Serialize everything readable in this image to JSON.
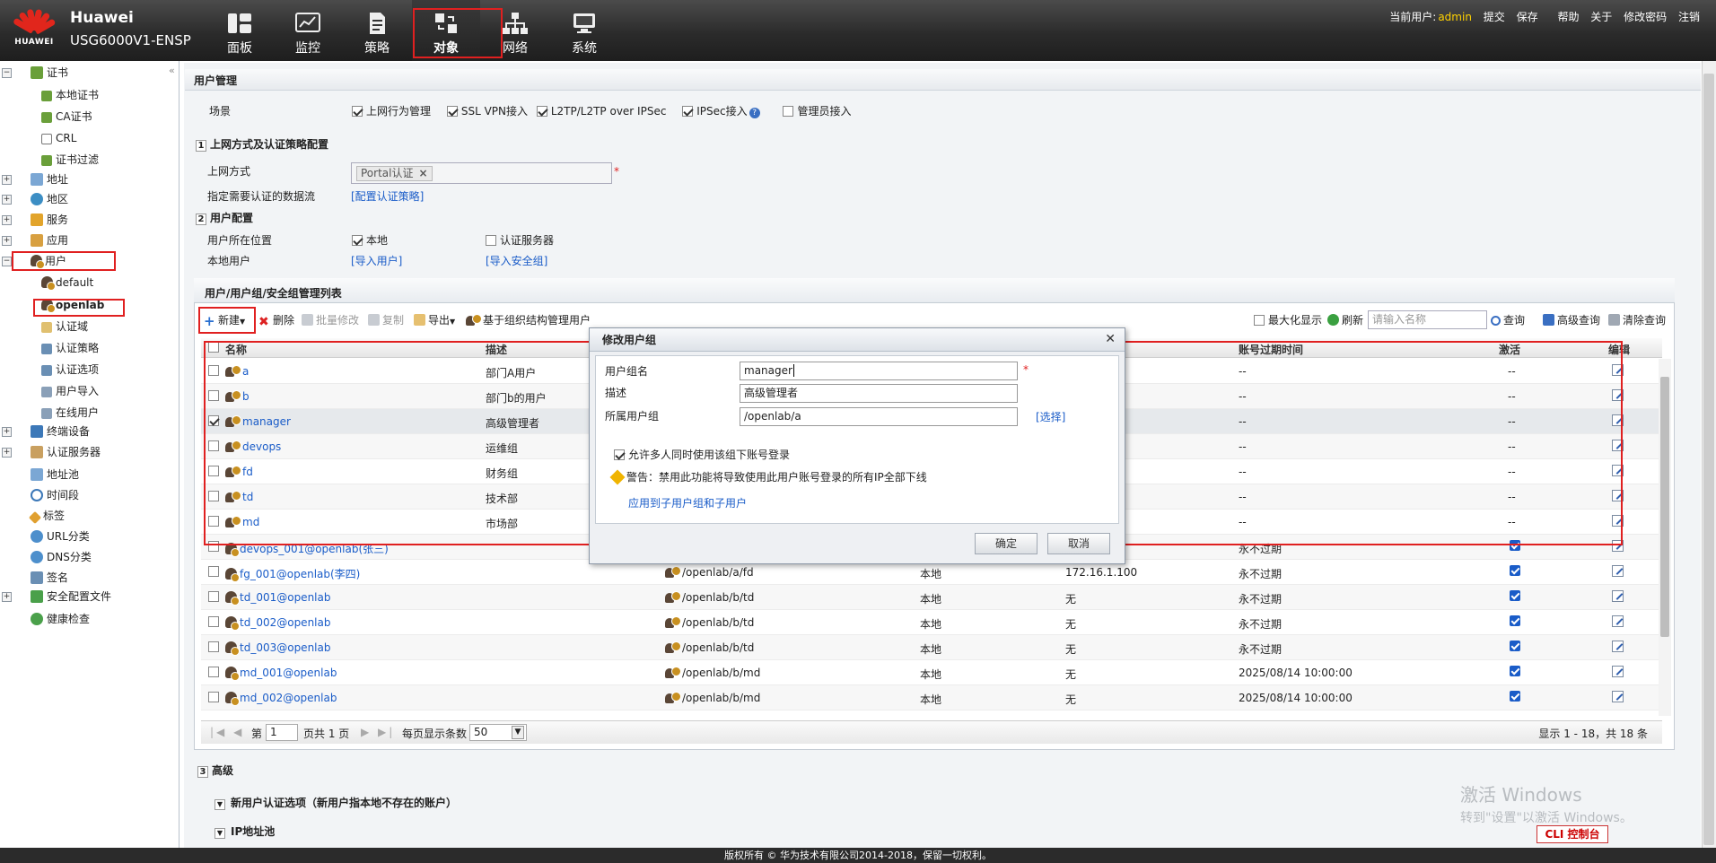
{
  "header": {
    "brand_name": "Huawei",
    "model": "USG6000V1-ENSP",
    "logo_text": "HUAWEI",
    "nav": [
      {
        "label": "面板",
        "icon": "dashboard-icon"
      },
      {
        "label": "监控",
        "icon": "monitor-icon"
      },
      {
        "label": "策略",
        "icon": "policy-icon"
      },
      {
        "label": "对象",
        "icon": "object-icon",
        "active": true
      },
      {
        "label": "网络",
        "icon": "network-icon"
      },
      {
        "label": "系统",
        "icon": "system-icon"
      }
    ],
    "current_user_label": "当前用户:",
    "current_user": "admin",
    "links": [
      "提交",
      "保存",
      "帮助",
      "关于",
      "修改密码",
      "注销"
    ]
  },
  "sidebar": {
    "cert": "证书",
    "cert_children": [
      "本地证书",
      "CA证书",
      "CRL",
      "证书过滤"
    ],
    "address": "地址",
    "region": "地区",
    "service": "服务",
    "application": "应用",
    "user": "用户",
    "user_children": [
      "default",
      "openlab",
      "认证域",
      "认证策略",
      "认证选项",
      "用户导入",
      "在线用户"
    ],
    "terminal": "终端设备",
    "auth_server": "认证服务器",
    "address_pool": "地址池",
    "time_range": "时间段",
    "tag": "标签",
    "url_category": "URL分类",
    "dns_category": "DNS分类",
    "signature": "签名",
    "security_profile": "安全配置文件",
    "health_check": "健康检查"
  },
  "main": {
    "title": "用户管理",
    "scene_label": "场景",
    "scenes": [
      "上网行为管理",
      "SSL VPN接入",
      "L2TP/L2TP over IPSec",
      "IPSec接入",
      "管理员接入"
    ],
    "sec1_num": "1",
    "sec1_title": "上网方式及认证策略配置",
    "access_mode_label": "上网方式",
    "access_mode_tag": "Portal认证",
    "auth_flow_label": "指定需要认证的数据流",
    "auth_flow_link": "[配置认证策略]",
    "sec2_num": "2",
    "sec2_title": "用户配置",
    "user_location_label": "用户所在位置",
    "loc_local": "本地",
    "loc_server": "认证服务器",
    "local_user_label": "本地用户",
    "import_user": "[导入用户]",
    "import_group": "[导入安全组]",
    "sec3_num": "3",
    "sec3_title": "高级",
    "adv_item1": "新用户认证选项（新用户指本地不存在的账户）",
    "adv_item2": "IP地址池"
  },
  "list": {
    "title": "用户/用户组/安全组管理列表",
    "toolbar": {
      "new": "新建",
      "delete": "删除",
      "batch_edit": "批量修改",
      "copy": "复制",
      "export": "导出",
      "org_manage": "基于组织结构管理用户",
      "maximize": "最大化显示",
      "refresh": "刷新",
      "search_placeholder": "请输入名称",
      "query": "查询",
      "adv_query": "高级查询",
      "clear_query": "清除查询"
    },
    "columns": {
      "name": "名称",
      "desc": "描述",
      "expire": "账号过期时间",
      "active": "激活",
      "edit": "编辑"
    },
    "groups": [
      {
        "name": "a",
        "desc": "部门A用户",
        "expire": "--",
        "active": "--"
      },
      {
        "name": "b",
        "desc": "部门b的用户",
        "expire": "--",
        "active": "--"
      },
      {
        "name": "manager",
        "desc": "高级管理者",
        "expire": "--",
        "active": "--"
      },
      {
        "name": "devops",
        "desc": "运维组",
        "expire": "--",
        "active": "--"
      },
      {
        "name": "fd",
        "desc": "财务组",
        "expire": "--",
        "active": "--"
      },
      {
        "name": "td",
        "desc": "技术部",
        "expire": "--",
        "active": "--"
      },
      {
        "name": "md",
        "desc": "市场部",
        "expire": "--",
        "active": "--"
      }
    ],
    "users": [
      {
        "name": "devops_001@openlab(张三)",
        "group": "",
        "loc": "",
        "ip": "",
        "expire": "永不过期"
      },
      {
        "name": "fg_001@openlab(李四)",
        "group": "/openlab/a/fd",
        "loc": "本地",
        "ip": "172.16.1.100",
        "expire": "永不过期"
      },
      {
        "name": "td_001@openlab",
        "group": "/openlab/b/td",
        "loc": "本地",
        "ip": "无",
        "expire": "永不过期"
      },
      {
        "name": "td_002@openlab",
        "group": "/openlab/b/td",
        "loc": "本地",
        "ip": "无",
        "expire": "永不过期"
      },
      {
        "name": "td_003@openlab",
        "group": "/openlab/b/td",
        "loc": "本地",
        "ip": "无",
        "expire": "永不过期"
      },
      {
        "name": "md_001@openlab",
        "group": "/openlab/b/md",
        "loc": "本地",
        "ip": "无",
        "expire": "2025/08/14 10:00:00"
      },
      {
        "name": "md_002@openlab",
        "group": "/openlab/b/md",
        "loc": "本地",
        "ip": "无",
        "expire": "2025/08/14 10:00:00"
      }
    ],
    "pager": {
      "page_prefix": "第",
      "page": "1",
      "page_suffix": "页共 1 页",
      "per_page_label": "每页显示条数",
      "per_page": "50",
      "summary": "显示 1 - 18，共 18 条"
    }
  },
  "dialog": {
    "title": "修改用户组",
    "name_label": "用户组名",
    "name_value": "manager",
    "desc_label": "描述",
    "desc_value": "高级管理者",
    "parent_label": "所属用户组",
    "parent_value": "/openlab/a",
    "select_link": "[选择]",
    "allow_multi": "允许多人同时使用该组下账号登录",
    "warning": "警告：禁用此功能将导致使用此用户账号登录的所有IP全部下线",
    "apply_link": "应用到子用户组和子用户",
    "ok": "确定",
    "cancel": "取消"
  },
  "footer": {
    "copyright": "版权所有 © 华为技术有限公司2014-2018，保留一切权利。",
    "watermark_title": "激活 Windows",
    "watermark_sub": "转到\"设置\"以激活 Windows。",
    "cli": "CLI 控制台"
  }
}
